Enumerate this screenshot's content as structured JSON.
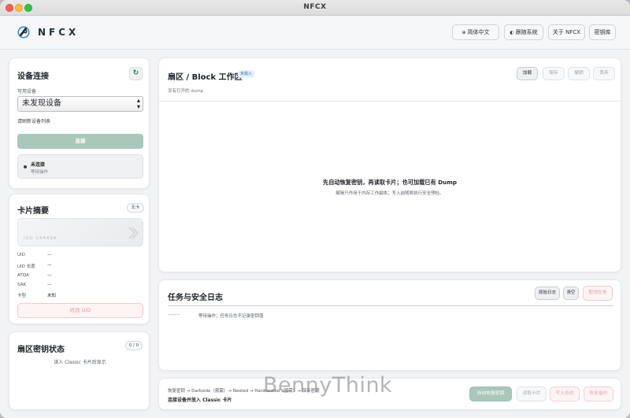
{
  "window": {
    "title": "NFCX"
  },
  "header": {
    "brand": "NFCX",
    "buttons": {
      "language": "简体中文",
      "theme": "跟随系统",
      "about": "关于 NFCX",
      "keystore": "密钥库"
    }
  },
  "device": {
    "title": "设备连接",
    "available_label": "可用设备",
    "select_value": "未发现设备",
    "refresh_hint": "请刷新设备列表",
    "connect_label": "连接",
    "status_title": "未连接",
    "status_sub": "等待操作"
  },
  "card": {
    "title": "卡片摘要",
    "chip": "无卡",
    "card_text": "ISO 14443A",
    "fields": [
      {
        "key": "UID",
        "value": "—"
      },
      {
        "key": "UID 长度",
        "value": "—"
      },
      {
        "key": "ATQA",
        "value": "—"
      },
      {
        "key": "SAK",
        "value": "—"
      },
      {
        "key": "卡型",
        "value": "未知"
      }
    ],
    "modify_uid": "修改 UID"
  },
  "sector_keys": {
    "title": "扇区密钥状态",
    "count": "0 / 0",
    "hint": "读入 Classic 卡片后显示"
  },
  "workspace": {
    "title": "扇区 / Block 工作区",
    "badge": "未载入",
    "subtitle": "没有打开的 dump",
    "buttons": {
      "load": "加载",
      "save": "保存",
      "undo": "撤销",
      "discard": "丢弃"
    },
    "empty_title": "先自动恢复密钥，再读取卡片；也可加载已有 Dump",
    "empty_sub": "编辑只作用于内存工作副本；写入前随将执行安全预检。"
  },
  "log": {
    "title": "任务与安全日志",
    "raw_log": "原始日志",
    "clear": "清空",
    "cancel_task": "取消任务",
    "time": "--:--:--",
    "message": "等待操作；任务日志不记录密钥值"
  },
  "footer": {
    "flow": "恢复密钥 → Darkside（按需）→ Nested → Hardnested（按需）→ 保存密钥",
    "hint": "连接设备并放入 Classic 卡片",
    "buttons": {
      "auto_recover": "自动恢复密钥",
      "read_card": "读取卡片",
      "write_modify": "写入修改",
      "restore_backup": "恢复备份"
    }
  },
  "watermark": "BennyThink"
}
